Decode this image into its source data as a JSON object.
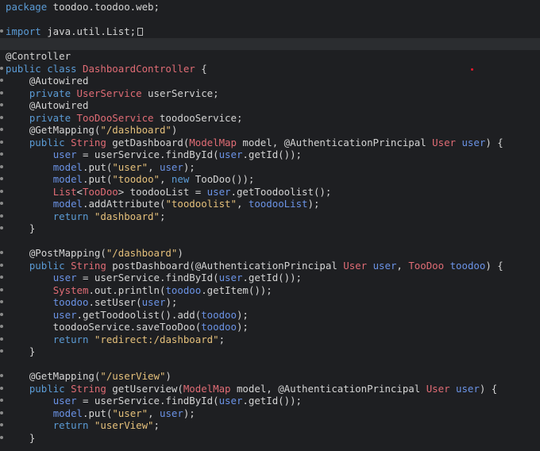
{
  "colors": {
    "background": "#1e1f22",
    "current_line": "#2b2d30",
    "text": "#d4d4d4",
    "keyword": "#5b9bd5",
    "type": "#e06c75",
    "variable": "#6b93e6",
    "string": "#e5c07b"
  },
  "editor": {
    "lines": [
      {
        "marker": false,
        "tokens": [
          {
            "t": "kw",
            "v": "package"
          },
          {
            "t": "p",
            "v": " toodoo.toodoo.web;"
          }
        ]
      },
      {
        "marker": false,
        "tokens": []
      },
      {
        "marker": true,
        "fold": true,
        "tokens": [
          {
            "t": "kw",
            "v": "import"
          },
          {
            "t": "p",
            "v": " java.util.List;"
          }
        ]
      },
      {
        "marker": false,
        "current": true,
        "tokens": []
      },
      {
        "marker": false,
        "tokens": [
          {
            "t": "p",
            "v": "@Controller"
          }
        ]
      },
      {
        "marker": true,
        "tokens": [
          {
            "t": "kw",
            "v": "public class"
          },
          {
            "t": "p",
            "v": " "
          },
          {
            "t": "type",
            "v": "DashboardController"
          },
          {
            "t": "p",
            "v": " {"
          }
        ]
      },
      {
        "marker": true,
        "tokens": [
          {
            "t": "p",
            "v": "    @Autowired"
          }
        ]
      },
      {
        "marker": true,
        "tokens": [
          {
            "t": "p",
            "v": "    "
          },
          {
            "t": "kw",
            "v": "private"
          },
          {
            "t": "p",
            "v": " "
          },
          {
            "t": "type",
            "v": "UserService"
          },
          {
            "t": "p",
            "v": " userService;"
          }
        ]
      },
      {
        "marker": true,
        "tokens": [
          {
            "t": "p",
            "v": "    @Autowired"
          }
        ]
      },
      {
        "marker": true,
        "tokens": [
          {
            "t": "p",
            "v": "    "
          },
          {
            "t": "kw",
            "v": "private"
          },
          {
            "t": "p",
            "v": " "
          },
          {
            "t": "type",
            "v": "TooDooService"
          },
          {
            "t": "p",
            "v": " toodooService;"
          }
        ]
      },
      {
        "marker": true,
        "tokens": [
          {
            "t": "p",
            "v": "    @GetMapping("
          },
          {
            "t": "str",
            "v": "\"/dashboard\""
          },
          {
            "t": "p",
            "v": ")"
          }
        ]
      },
      {
        "marker": true,
        "tokens": [
          {
            "t": "p",
            "v": "    "
          },
          {
            "t": "kw",
            "v": "public"
          },
          {
            "t": "p",
            "v": " "
          },
          {
            "t": "type",
            "v": "String"
          },
          {
            "t": "p",
            "v": " getDashboard("
          },
          {
            "t": "type",
            "v": "ModelMap"
          },
          {
            "t": "p",
            "v": " model, @AuthenticationPrincipal "
          },
          {
            "t": "type",
            "v": "User"
          },
          {
            "t": "p",
            "v": " "
          },
          {
            "t": "var",
            "v": "user"
          },
          {
            "t": "p",
            "v": ") {"
          }
        ]
      },
      {
        "marker": true,
        "tokens": [
          {
            "t": "p",
            "v": "        "
          },
          {
            "t": "var",
            "v": "user"
          },
          {
            "t": "p",
            "v": " = userService.findById("
          },
          {
            "t": "var",
            "v": "user"
          },
          {
            "t": "p",
            "v": ".getId());"
          }
        ]
      },
      {
        "marker": true,
        "tokens": [
          {
            "t": "p",
            "v": "        "
          },
          {
            "t": "var",
            "v": "model"
          },
          {
            "t": "p",
            "v": ".put("
          },
          {
            "t": "str",
            "v": "\"user\""
          },
          {
            "t": "p",
            "v": ", "
          },
          {
            "t": "var",
            "v": "user"
          },
          {
            "t": "p",
            "v": ");"
          }
        ]
      },
      {
        "marker": true,
        "tokens": [
          {
            "t": "p",
            "v": "        "
          },
          {
            "t": "var",
            "v": "model"
          },
          {
            "t": "p",
            "v": ".put("
          },
          {
            "t": "str",
            "v": "\"toodoo\""
          },
          {
            "t": "p",
            "v": ", "
          },
          {
            "t": "kw",
            "v": "new"
          },
          {
            "t": "p",
            "v": " TooDoo());"
          }
        ]
      },
      {
        "marker": true,
        "tokens": [
          {
            "t": "p",
            "v": "        "
          },
          {
            "t": "type",
            "v": "List"
          },
          {
            "t": "p",
            "v": "<"
          },
          {
            "t": "type",
            "v": "TooDoo"
          },
          {
            "t": "p",
            "v": "> toodooList = "
          },
          {
            "t": "var",
            "v": "user"
          },
          {
            "t": "p",
            "v": ".getToodoolist();"
          }
        ]
      },
      {
        "marker": true,
        "tokens": [
          {
            "t": "p",
            "v": "        "
          },
          {
            "t": "var",
            "v": "model"
          },
          {
            "t": "p",
            "v": ".addAttribute("
          },
          {
            "t": "str",
            "v": "\"toodoolist\""
          },
          {
            "t": "p",
            "v": ", "
          },
          {
            "t": "var",
            "v": "toodooList"
          },
          {
            "t": "p",
            "v": ");"
          }
        ]
      },
      {
        "marker": true,
        "tokens": [
          {
            "t": "p",
            "v": "        "
          },
          {
            "t": "kw",
            "v": "return"
          },
          {
            "t": "p",
            "v": " "
          },
          {
            "t": "str",
            "v": "\"dashboard\""
          },
          {
            "t": "p",
            "v": ";"
          }
        ]
      },
      {
        "marker": true,
        "tokens": [
          {
            "t": "p",
            "v": "    }"
          }
        ]
      },
      {
        "marker": false,
        "tokens": []
      },
      {
        "marker": true,
        "tokens": [
          {
            "t": "p",
            "v": "    @PostMapping("
          },
          {
            "t": "str",
            "v": "\"/dashboard\""
          },
          {
            "t": "p",
            "v": ")"
          }
        ]
      },
      {
        "marker": true,
        "tokens": [
          {
            "t": "p",
            "v": "    "
          },
          {
            "t": "kw",
            "v": "public"
          },
          {
            "t": "p",
            "v": " "
          },
          {
            "t": "type",
            "v": "String"
          },
          {
            "t": "p",
            "v": " postDashboard(@AuthenticationPrincipal "
          },
          {
            "t": "type",
            "v": "User"
          },
          {
            "t": "p",
            "v": " "
          },
          {
            "t": "var",
            "v": "user"
          },
          {
            "t": "p",
            "v": ", "
          },
          {
            "t": "type",
            "v": "TooDoo"
          },
          {
            "t": "p",
            "v": " "
          },
          {
            "t": "var",
            "v": "toodoo"
          },
          {
            "t": "p",
            "v": ") {"
          }
        ]
      },
      {
        "marker": true,
        "tokens": [
          {
            "t": "p",
            "v": "        "
          },
          {
            "t": "var",
            "v": "user"
          },
          {
            "t": "p",
            "v": " = userService.findById("
          },
          {
            "t": "var",
            "v": "user"
          },
          {
            "t": "p",
            "v": ".getId());"
          }
        ]
      },
      {
        "marker": true,
        "tokens": [
          {
            "t": "p",
            "v": "        "
          },
          {
            "t": "type",
            "v": "System"
          },
          {
            "t": "p",
            "v": ".out.println("
          },
          {
            "t": "var",
            "v": "toodoo"
          },
          {
            "t": "p",
            "v": ".getItem());"
          }
        ]
      },
      {
        "marker": true,
        "tokens": [
          {
            "t": "p",
            "v": "        "
          },
          {
            "t": "var",
            "v": "toodoo"
          },
          {
            "t": "p",
            "v": ".setUser("
          },
          {
            "t": "var",
            "v": "user"
          },
          {
            "t": "p",
            "v": ");"
          }
        ]
      },
      {
        "marker": true,
        "tokens": [
          {
            "t": "p",
            "v": "        "
          },
          {
            "t": "var",
            "v": "user"
          },
          {
            "t": "p",
            "v": ".getToodoolist().add("
          },
          {
            "t": "var",
            "v": "toodoo"
          },
          {
            "t": "p",
            "v": ");"
          }
        ]
      },
      {
        "marker": true,
        "tokens": [
          {
            "t": "p",
            "v": "        toodooService.saveTooDoo("
          },
          {
            "t": "var",
            "v": "toodoo"
          },
          {
            "t": "p",
            "v": ");"
          }
        ]
      },
      {
        "marker": true,
        "tokens": [
          {
            "t": "p",
            "v": "        "
          },
          {
            "t": "kw",
            "v": "return"
          },
          {
            "t": "p",
            "v": " "
          },
          {
            "t": "str",
            "v": "\"redirect:/dashboard\""
          },
          {
            "t": "p",
            "v": ";"
          }
        ]
      },
      {
        "marker": true,
        "tokens": [
          {
            "t": "p",
            "v": "    }"
          }
        ]
      },
      {
        "marker": false,
        "tokens": []
      },
      {
        "marker": true,
        "tokens": [
          {
            "t": "p",
            "v": "    @GetMapping("
          },
          {
            "t": "str",
            "v": "\"/userView\""
          },
          {
            "t": "p",
            "v": ")"
          }
        ]
      },
      {
        "marker": true,
        "tokens": [
          {
            "t": "p",
            "v": "    "
          },
          {
            "t": "kw",
            "v": "public"
          },
          {
            "t": "p",
            "v": " "
          },
          {
            "t": "type",
            "v": "String"
          },
          {
            "t": "p",
            "v": " getUserview("
          },
          {
            "t": "type",
            "v": "ModelMap"
          },
          {
            "t": "p",
            "v": " model, @AuthenticationPrincipal "
          },
          {
            "t": "type",
            "v": "User"
          },
          {
            "t": "p",
            "v": " "
          },
          {
            "t": "var",
            "v": "user"
          },
          {
            "t": "p",
            "v": ") {"
          }
        ]
      },
      {
        "marker": true,
        "tokens": [
          {
            "t": "p",
            "v": "        "
          },
          {
            "t": "var",
            "v": "user"
          },
          {
            "t": "p",
            "v": " = userService.findById("
          },
          {
            "t": "var",
            "v": "user"
          },
          {
            "t": "p",
            "v": ".getId());"
          }
        ]
      },
      {
        "marker": true,
        "tokens": [
          {
            "t": "p",
            "v": "        "
          },
          {
            "t": "var",
            "v": "model"
          },
          {
            "t": "p",
            "v": ".put("
          },
          {
            "t": "str",
            "v": "\"user\""
          },
          {
            "t": "p",
            "v": ", "
          },
          {
            "t": "var",
            "v": "user"
          },
          {
            "t": "p",
            "v": ");"
          }
        ]
      },
      {
        "marker": true,
        "tokens": [
          {
            "t": "p",
            "v": "        "
          },
          {
            "t": "kw",
            "v": "return"
          },
          {
            "t": "p",
            "v": " "
          },
          {
            "t": "str",
            "v": "\"userView\""
          },
          {
            "t": "p",
            "v": ";"
          }
        ]
      },
      {
        "marker": true,
        "tokens": [
          {
            "t": "p",
            "v": "    }"
          }
        ]
      }
    ]
  }
}
